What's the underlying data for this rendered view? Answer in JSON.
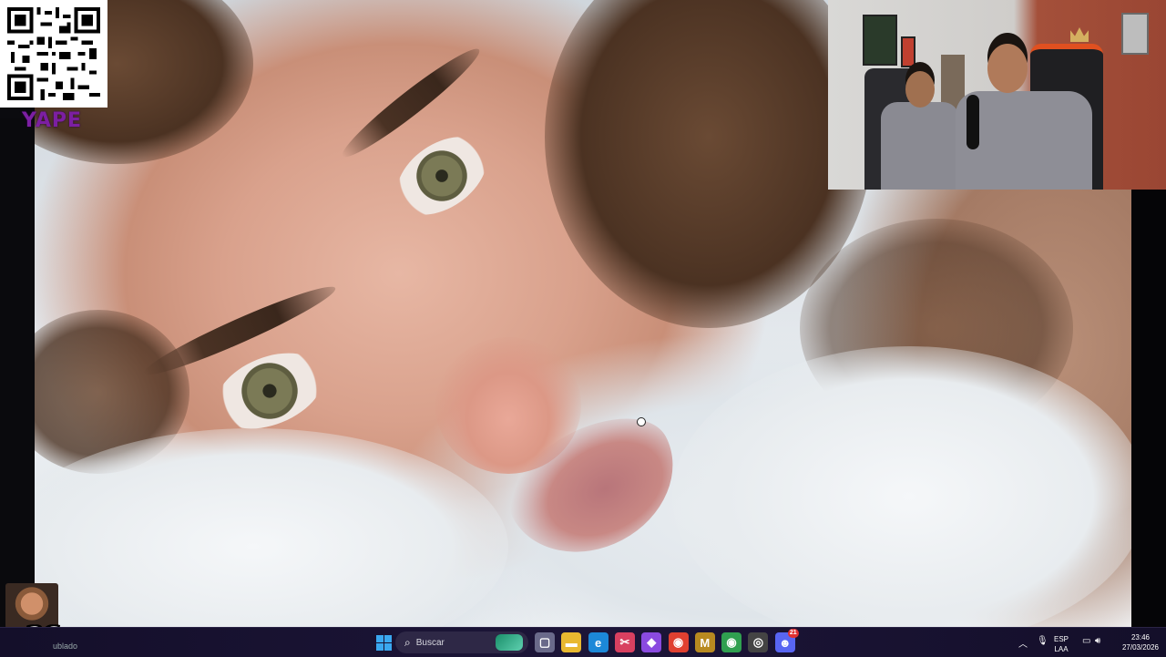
{
  "overlay": {
    "qr_label": "YAPE",
    "emote_combo": "x26",
    "chat_fragment": "ublado"
  },
  "taskbar": {
    "search_placeholder": "Buscar",
    "language_top": "ESP",
    "language_bottom": "LAA",
    "time": "23:46",
    "date": "27/03/2026",
    "discord_badge": "21",
    "apps": [
      {
        "name": "task-view-icon",
        "glyph": "▢",
        "color": "#6a6a8a"
      },
      {
        "name": "file-explorer-icon",
        "glyph": "▬",
        "color": "#e8b830"
      },
      {
        "name": "edge-browser-icon",
        "glyph": "e",
        "color": "#1c88d8"
      },
      {
        "name": "snipping-tool-icon",
        "glyph": "✂",
        "color": "#d84060"
      },
      {
        "name": "copilot-icon",
        "glyph": "◆",
        "color": "#8a4ae0"
      },
      {
        "name": "chrome-icon",
        "glyph": "◉",
        "color": "#e04030"
      },
      {
        "name": "winamp-icon",
        "glyph": "M",
        "color": "#b88a20"
      },
      {
        "name": "chrome-profile-icon",
        "glyph": "◉",
        "color": "#30a050"
      },
      {
        "name": "obs-icon",
        "glyph": "◎",
        "color": "#444"
      },
      {
        "name": "discord-icon",
        "glyph": "☻",
        "color": "#5865f2"
      }
    ]
  }
}
